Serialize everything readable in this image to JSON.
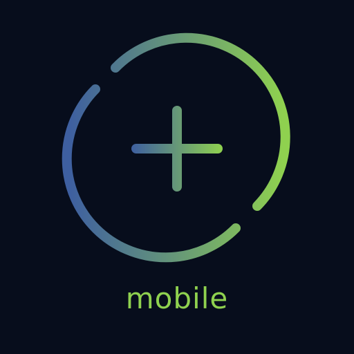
{
  "app": {
    "wordmark": "mobile"
  },
  "logo": {
    "icon": "circle-plus-icon",
    "gradient_start": "#3e5fa0",
    "gradient_end": "#8fd14f",
    "background": "#070d1c"
  }
}
